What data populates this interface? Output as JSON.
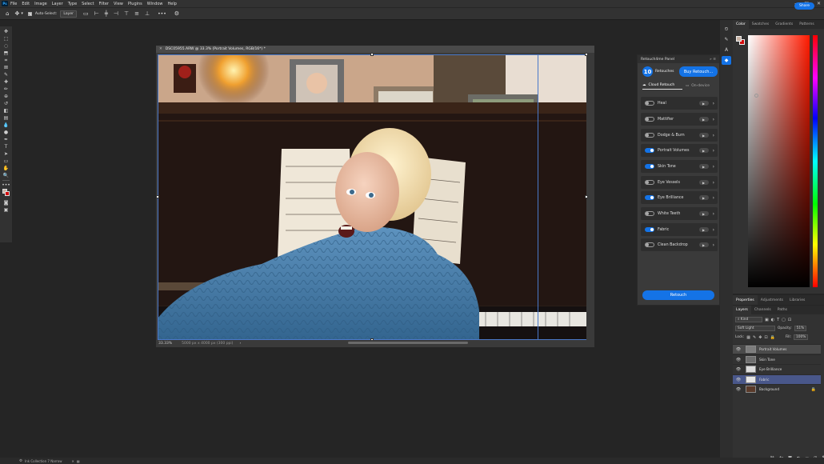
{
  "menu": {
    "app_icon": "Ps",
    "items": [
      "File",
      "Edit",
      "Image",
      "Layer",
      "Type",
      "Select",
      "Filter",
      "View",
      "Plugins",
      "Window",
      "Help"
    ]
  },
  "options_bar": {
    "auto_select_label": "Auto-Select:",
    "auto_select_value": "Layer",
    "more": "•••",
    "share_label": "Share"
  },
  "document": {
    "tab_title": "DSC05955.ARW @ 33.3% (Portrait Volumes, RGB/16*) *",
    "zoom": "33.33%",
    "size_info": "5000 px x 4000 px (300 ppi)",
    "status_arrow": "›"
  },
  "retouch_panel": {
    "title": "Retouch4me Panel",
    "count": "10",
    "count_label": "Retouches",
    "buy_label": "Buy Retouch...",
    "tab_cloud": "Cloud Retouch",
    "tab_device": "On-device",
    "items": [
      {
        "name": "Heal",
        "on": false
      },
      {
        "name": "Mattifier",
        "on": false
      },
      {
        "name": "Dodge & Burn",
        "on": false
      },
      {
        "name": "Portrait Volumes",
        "on": true
      },
      {
        "name": "Skin Tone",
        "on": true
      },
      {
        "name": "Eye Vessels",
        "on": false
      },
      {
        "name": "Eye Brilliance",
        "on": true
      },
      {
        "name": "White Teeth",
        "on": false
      },
      {
        "name": "Fabric",
        "on": true
      },
      {
        "name": "Clean Backdrop",
        "on": false
      }
    ],
    "retouch_button": "Retouch"
  },
  "color_panel": {
    "tabs": [
      "Color",
      "Swatches",
      "Gradients",
      "Patterns"
    ],
    "fg_color": "#c9b4a6",
    "bg_color": "#d10c0c"
  },
  "properties_panel": {
    "tabs": [
      "Properties",
      "Adjustments",
      "Libraries"
    ]
  },
  "layers_panel": {
    "tabs": [
      "Layers",
      "Channels",
      "Paths"
    ],
    "filter_label": "Kind",
    "blend_mode": "Soft Light",
    "opacity_label": "Opacity:",
    "opacity_value": "51%",
    "lock_label": "Lock:",
    "fill_label": "Fill:",
    "fill_value": "100%",
    "layers": [
      {
        "name": "Portrait Volumes",
        "thumb": "#7d7d7d",
        "state": "sel"
      },
      {
        "name": "Skin Tone",
        "thumb": "#6e6e6e",
        "state": ""
      },
      {
        "name": "Eye Brilliance",
        "thumb": "#dcdcdc",
        "state": ""
      },
      {
        "name": "Fabric",
        "thumb": "#e6e6e6",
        "state": "sel2"
      },
      {
        "name": "Background",
        "thumb": "#5a3a2a",
        "state": ""
      }
    ]
  },
  "bottom_status": {
    "label": "Ink Collection 7 Narrow"
  }
}
